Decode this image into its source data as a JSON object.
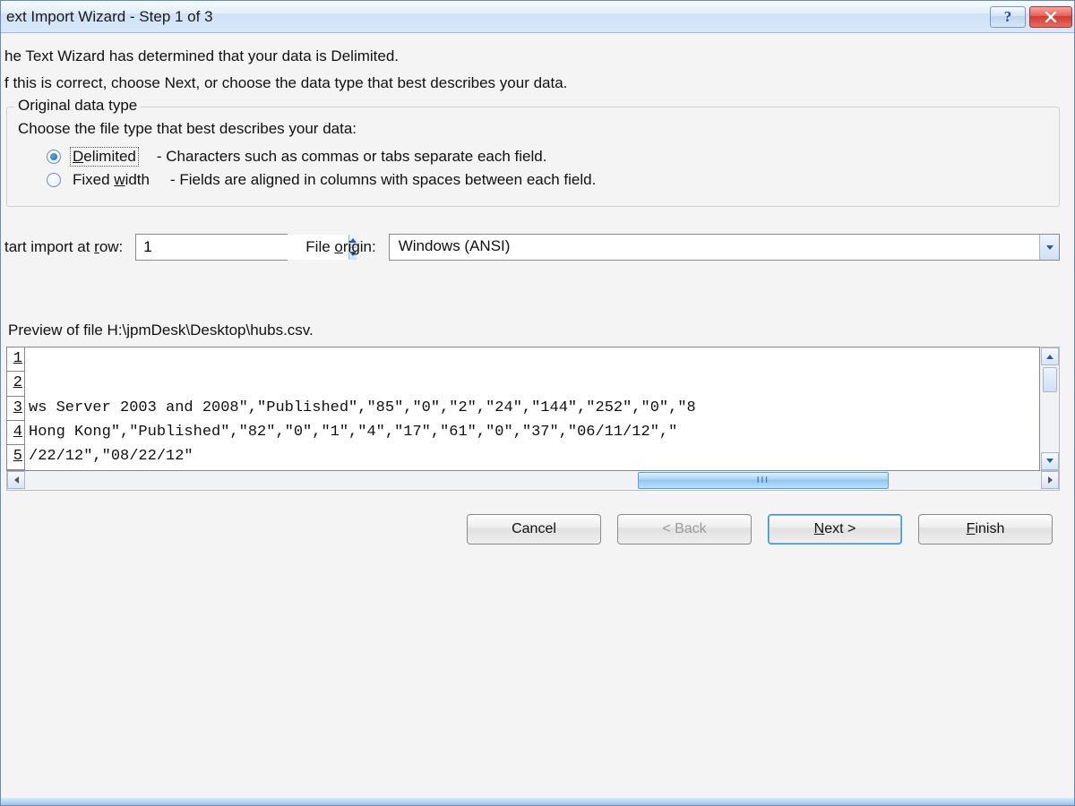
{
  "titlebar": {
    "title": "ext Import Wizard - Step 1 of 3",
    "help": "?",
    "close": "X"
  },
  "intro": {
    "line1": "he Text Wizard has determined that your data is Delimited.",
    "line2": "f this is correct, choose Next, or choose the data type that best describes your data."
  },
  "group": {
    "legend": "Original data type",
    "desc": "Choose the file type that best describes your data:",
    "delimited": {
      "label_left": "D",
      "label_rest": "elimited",
      "desc": "- Characters such as commas or tabs separate each field."
    },
    "fixed": {
      "label_left": "Fixed ",
      "label_ul": "w",
      "label_rest": "idth",
      "desc": "- Fields are aligned in columns with spaces between each field."
    }
  },
  "import_row": {
    "start_label_pre": "tart import at ",
    "start_label_ul": "r",
    "start_label_post": "ow:",
    "start_value": "1",
    "origin_label_pre": "File ",
    "origin_label_ul": "o",
    "origin_label_post": "rigin:",
    "origin_value": "Windows (ANSI)"
  },
  "preview": {
    "label": "Preview of file H:\\jpmDesk\\Desktop\\hubs.csv.",
    "lines": [
      {
        "n": "1",
        "t": ""
      },
      {
        "n": "2",
        "t": ""
      },
      {
        "n": "3",
        "t": "ws Server 2003 and 2008\",\"Published\",\"85\",\"0\",\"2\",\"24\",\"144\",\"252\",\"0\",\"8"
      },
      {
        "n": "4",
        "t": " Hong Kong\",\"Published\",\"82\",\"0\",\"1\",\"4\",\"17\",\"61\",\"0\",\"37\",\"06/11/12\",\""
      },
      {
        "n": "5",
        "t": "/22/12\",\"08/22/12\""
      }
    ],
    "hthumb_mark": "III"
  },
  "buttons": {
    "cancel": "Cancel",
    "back": "< Back",
    "next_ul": "N",
    "next_rest": "ext >",
    "finish_ul": "F",
    "finish_rest": "inish"
  }
}
